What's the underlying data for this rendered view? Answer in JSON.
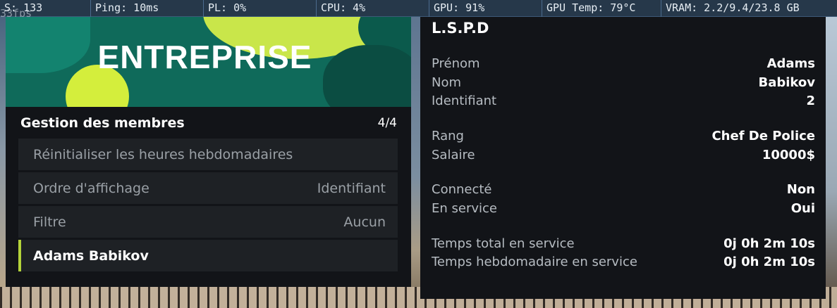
{
  "overlay": {
    "cells": [
      {
        "text": "S: 133"
      },
      {
        "text": "Ping: 10ms"
      },
      {
        "text": "PL: 0%"
      },
      {
        "text": "CPU: 4%"
      },
      {
        "text": "GPU: 91%"
      },
      {
        "text": "GPU Temp: 79°C"
      },
      {
        "text": "VRAM: 2.2/9.4/23.8 GB"
      }
    ],
    "ghost_text": "33fps"
  },
  "menu": {
    "banner_title": "ENTREPRISE",
    "header_title": "Gestion des membres",
    "page_count": "4/4",
    "items": [
      {
        "label": "Réinitialiser les heures hebdomadaires",
        "value": ""
      },
      {
        "label": "Ordre d'affichage",
        "value": "Identifiant"
      },
      {
        "label": "Filtre",
        "value": "Aucun"
      },
      {
        "label": "Adams Babikov",
        "value": ""
      }
    ],
    "accent_color": "#b4d33a"
  },
  "info": {
    "title": "L.S.P.D",
    "groups": [
      {
        "rows": [
          {
            "key": "Prénom",
            "value": "Adams"
          },
          {
            "key": "Nom",
            "value": "Babikov"
          },
          {
            "key": "Identifiant",
            "value": "2"
          }
        ]
      },
      {
        "rows": [
          {
            "key": "Rang",
            "value": "Chef De Police"
          },
          {
            "key": "Salaire",
            "value": "10000$"
          }
        ]
      },
      {
        "rows": [
          {
            "key": "Connecté",
            "value": "Non"
          },
          {
            "key": "En service",
            "value": "Oui"
          }
        ]
      },
      {
        "rows": [
          {
            "key": "Temps total en service",
            "value": "0j 0h 2m 10s"
          },
          {
            "key": "Temps hebdomadaire en service",
            "value": "0j 0h 2m 10s"
          }
        ]
      }
    ]
  }
}
